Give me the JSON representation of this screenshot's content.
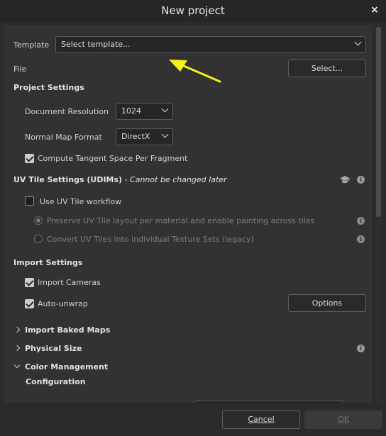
{
  "window": {
    "title": "New project",
    "close_icon": "×"
  },
  "template": {
    "label": "Template",
    "value": "Select template..."
  },
  "file": {
    "label": "File",
    "button": "Select..."
  },
  "project_settings": {
    "heading": "Project Settings",
    "document_resolution": {
      "label": "Document Resolution",
      "value": "1024"
    },
    "normal_map_format": {
      "label": "Normal Map Format",
      "value": "DirectX"
    },
    "compute_tangent": {
      "label": "Compute Tangent Space Per Fragment",
      "checked": true
    }
  },
  "uv_tile": {
    "heading": "UV Tile Settings (UDIMs)",
    "note": " - Cannot be changed later",
    "use_workflow": {
      "label": "Use UV Tile workflow",
      "checked": false
    },
    "preserve_option": "Preserve UV Tile layout per material and enable painting across tiles",
    "convert_option": "Convert UV Tiles into individual Texture Sets (legacy)"
  },
  "import_settings": {
    "heading": "Import Settings",
    "import_cameras": {
      "label": "Import Cameras",
      "checked": true
    },
    "auto_unwrap": {
      "label": "Auto-unwrap",
      "checked": true
    },
    "options_button": "Options"
  },
  "sections": {
    "baked_maps": "Import Baked Maps",
    "physical_size": "Physical Size",
    "color_management": "Color Management",
    "configuration": "Configuration"
  },
  "footer": {
    "cancel": "Cancel",
    "ok": "OK"
  },
  "colors": {
    "annotation_arrow": "#f5f01e",
    "background": "#323232"
  }
}
